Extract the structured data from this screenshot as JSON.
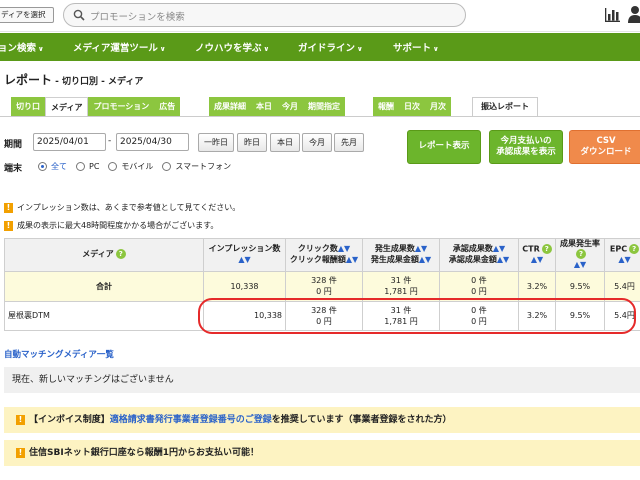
{
  "top": {
    "media_select": "ディアを選択",
    "search_placeholder": "プロモーションを検索"
  },
  "nav": [
    {
      "label": "ョン検索"
    },
    {
      "label": "メディア運営ツール"
    },
    {
      "label": "ノウハウを学ぶ"
    },
    {
      "label": "ガイドライン"
    },
    {
      "label": "サポート"
    }
  ],
  "title": {
    "main": "レポート",
    "sub": " - 切り口別 - メディア"
  },
  "tabs_report": [
    "切り口",
    "メディア",
    "プロモーション",
    "広告"
  ],
  "tabs_result": [
    "成果詳細",
    "本日",
    "今月",
    "期間指定"
  ],
  "tabs_reward": [
    "報酬",
    "日次",
    "月次"
  ],
  "tab_single": "振込レポート",
  "period": {
    "label": "期間",
    "from": "2025/04/01",
    "sep": "-",
    "to": "2025/04/30",
    "quick": [
      "一昨日",
      "昨日",
      "本日",
      "今月",
      "先月"
    ]
  },
  "buttons": {
    "show_report": "レポート表示",
    "show_approved_1": "今月支払いの",
    "show_approved_2": "承認成果を表示",
    "csv_1": "CSV",
    "csv_2": "ダウンロード"
  },
  "device": {
    "label": "端末",
    "options": [
      "全て",
      "PC",
      "モバイル",
      "スマートフォン"
    ],
    "selected": "全て"
  },
  "notices": [
    "インプレッション数は、あくまで参考値として見てください。",
    "成果の表示に最大48時間程度かかる場合がございます。"
  ],
  "table": {
    "headers": {
      "media": "メディア",
      "imp": "インプレッション数",
      "click1": "クリック数",
      "click2": "クリック報酬額",
      "occ1": "発生成果数",
      "occ2": "発生成果金額",
      "app1": "承認成果数",
      "app2": "承認成果金額",
      "ctr": "CTR",
      "rate": "成果発生率",
      "epc": "EPC"
    },
    "sort": "▲▼",
    "total": {
      "label": "合計",
      "imp": "10,338",
      "clicks": "328 件",
      "click_reward": "0 円",
      "occ": "31 件",
      "occ_amount": "1,781 円",
      "app": "0 件",
      "app_amount": "0 円",
      "ctr": "3.2%",
      "rate": "9.5%",
      "epc": "5.4円"
    },
    "row": {
      "media": "屋根裏DTM",
      "imp": "10,338",
      "clicks": "328 件",
      "click_reward": "0 円",
      "occ": "31 件",
      "occ_amount": "1,781 円",
      "app": "0 件",
      "app_amount": "0 円",
      "ctr": "3.2%",
      "rate": "9.5%",
      "epc": "5.4円"
    }
  },
  "auto_match": {
    "title": "自動マッチングメディア一覧",
    "empty": "現在、新しいマッチングはございません"
  },
  "banners": {
    "invoice_pre": "【インボイス制度】",
    "invoice_link": "適格請求書発行事業者登録番号のご登録",
    "invoice_post": "を推奨しています（事業者登録をされた方）",
    "sbi": "住信SBIネット銀行口座なら報酬1円からお支払い可能！"
  },
  "colors": {
    "nav_green": "#5a9a18",
    "tab_green": "#8cc63f",
    "csv_orange": "#f08a4b",
    "highlight_red": "#e52a2a"
  }
}
